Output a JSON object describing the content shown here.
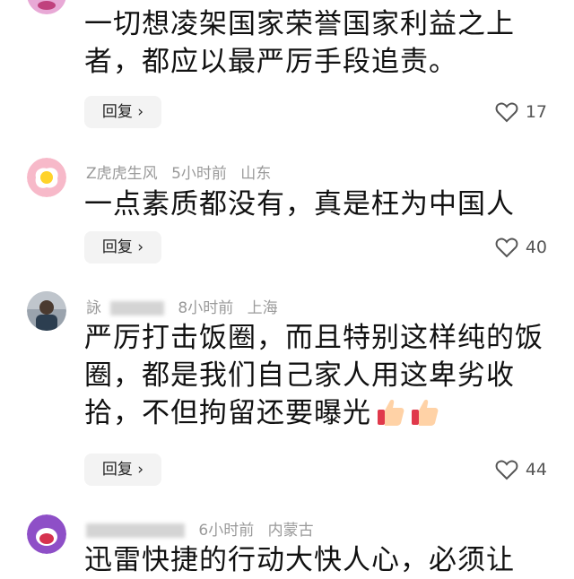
{
  "comments": [
    {
      "meta": {
        "user": "",
        "time": "",
        "location": ""
      },
      "text": "一切想凌架国家荣誉国家利益之上者，都应以最严厉手段追责。",
      "reply_label": "回复 ›",
      "likes": "17"
    },
    {
      "meta": {
        "user": "Z虎虎生风",
        "time": "5小时前",
        "location": "山东"
      },
      "text": "一点素质都没有，真是枉为中国人",
      "reply_label": "回复 ›",
      "likes": "40"
    },
    {
      "meta": {
        "user": "詠",
        "time": "8小时前",
        "location": "上海"
      },
      "text": "严厉打击饭圈，而且特别这样纯的饭圈，都是我们自己家人用这卑劣收拾，不但拘留还要曝光",
      "reply_label": "回复 ›",
      "likes": "44"
    },
    {
      "meta": {
        "user": "",
        "time": "6小时前",
        "location": "内蒙古"
      },
      "text": "迅雷快捷的行动大快人心，必须让",
      "reply_label": "",
      "likes": ""
    }
  ],
  "icons": {
    "like": "heart-outline-icon",
    "thumbs": "thumbs-up-emoji"
  }
}
